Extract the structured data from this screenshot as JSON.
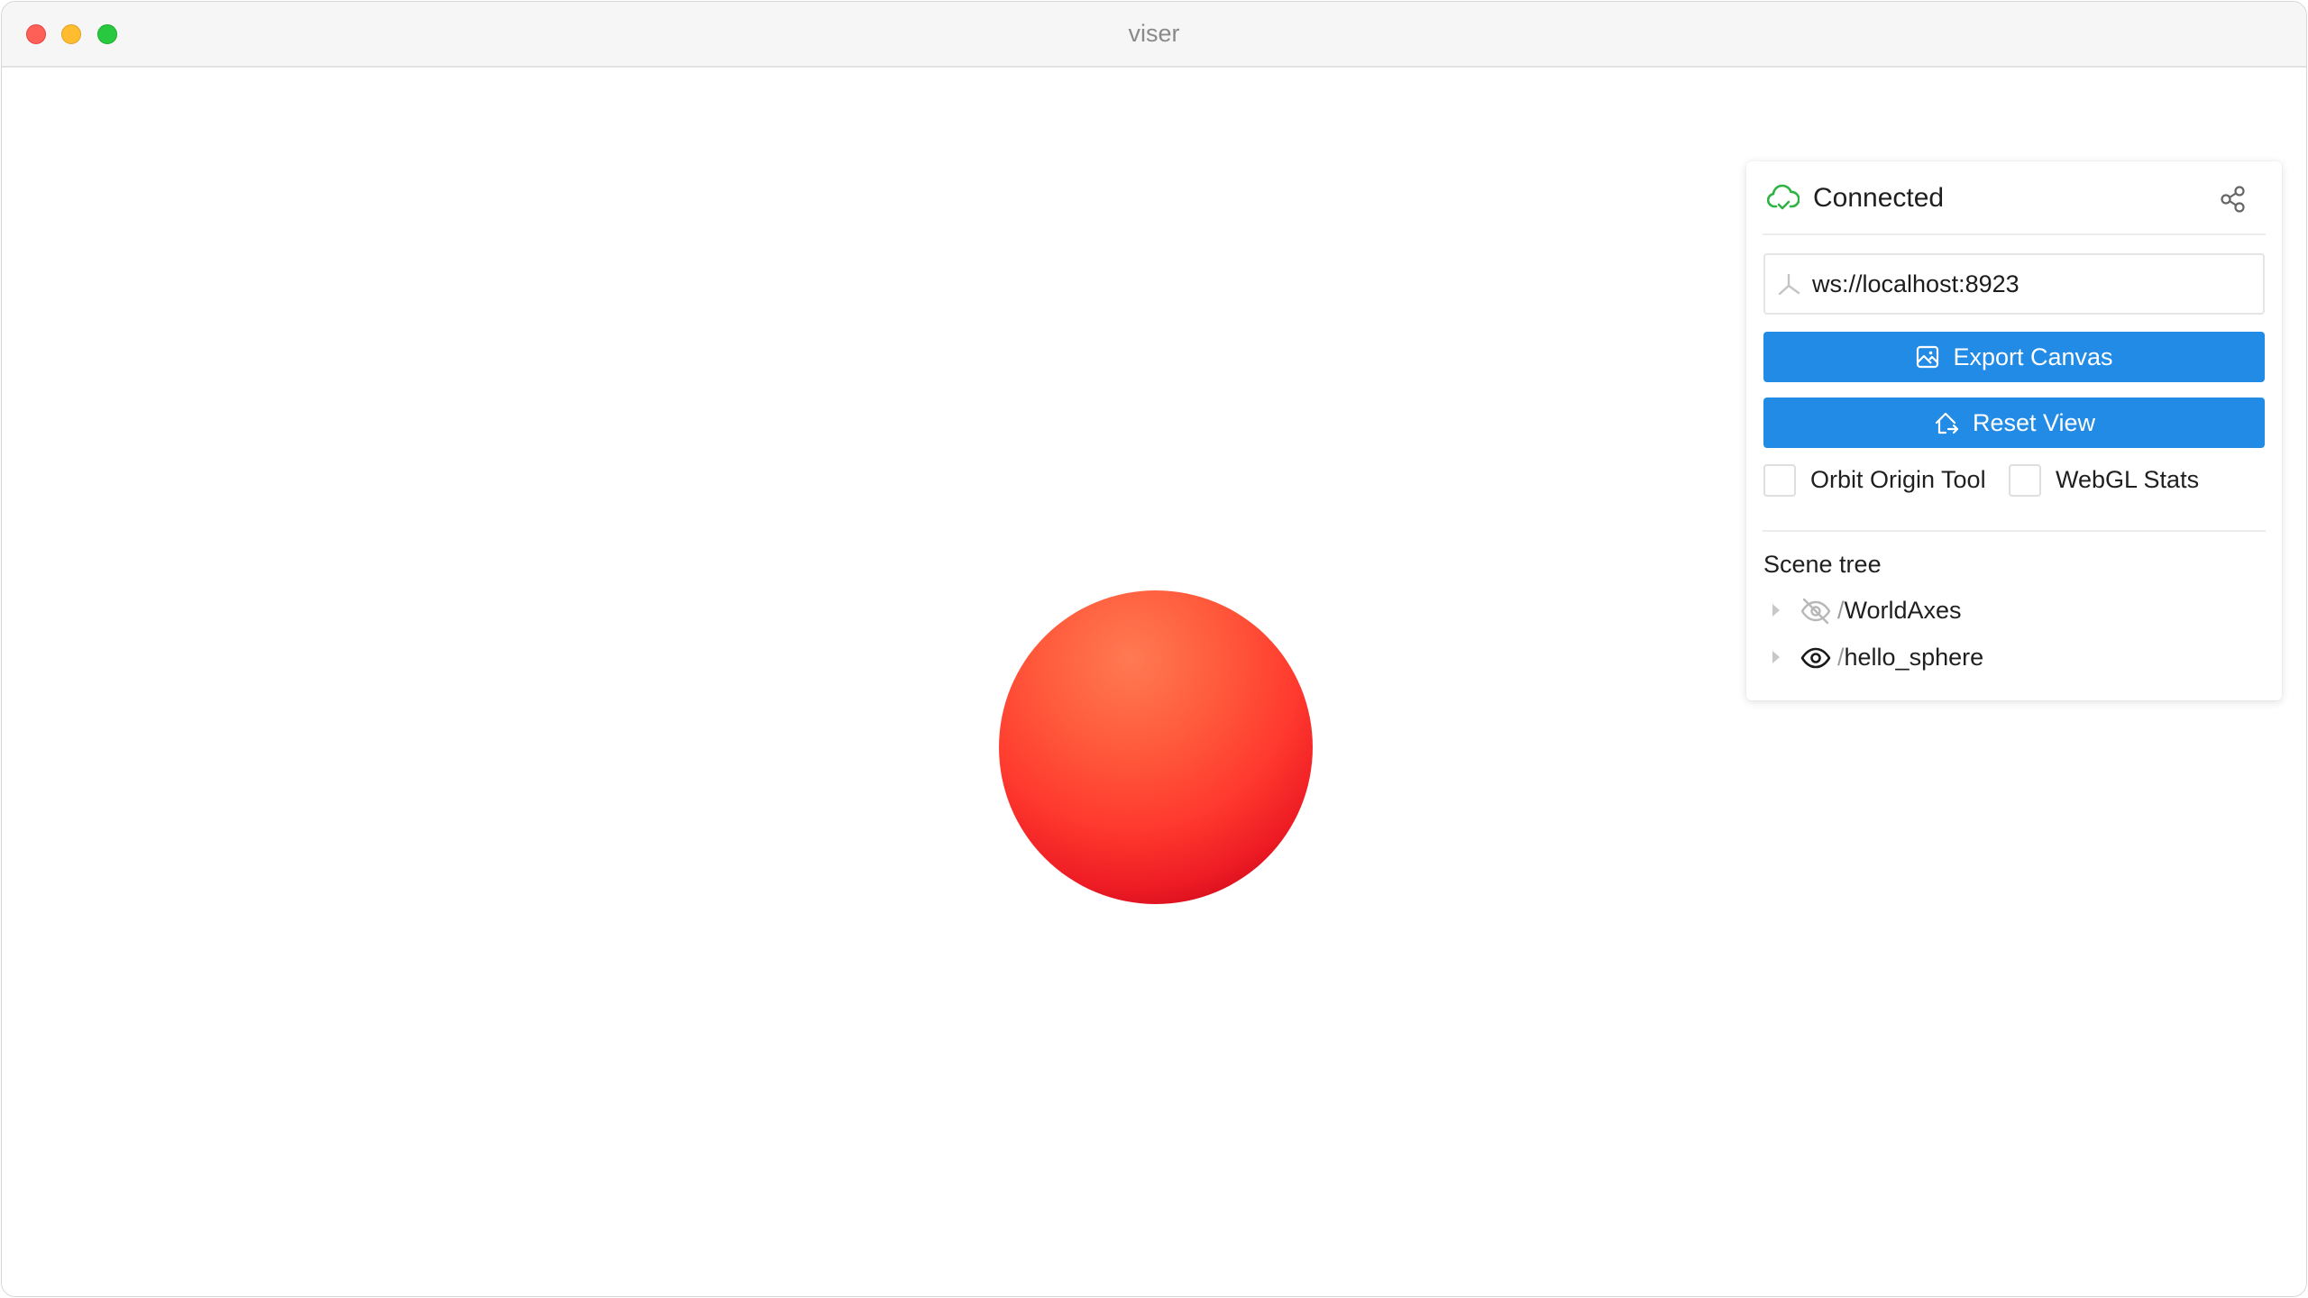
{
  "window": {
    "title": "viser"
  },
  "panel": {
    "connection_status": "Connected",
    "server_url": "ws://localhost:8923",
    "buttons": {
      "export_label": "Export Canvas",
      "reset_label": "Reset View"
    },
    "checkboxes": [
      {
        "label": "Orbit Origin Tool",
        "checked": false
      },
      {
        "label": "WebGL Stats",
        "checked": false
      }
    ],
    "scene_tree": {
      "title": "Scene tree",
      "items": [
        {
          "prefix": "/",
          "name": "WorldAxes",
          "visible": false,
          "icon": "eye-off-icon"
        },
        {
          "prefix": "/",
          "name": "hello_sphere",
          "visible": true,
          "icon": "eye-icon"
        }
      ]
    }
  },
  "colors": {
    "accent": "#228be6",
    "connected": "#2fb344",
    "sphere": "#ff3a2e"
  }
}
